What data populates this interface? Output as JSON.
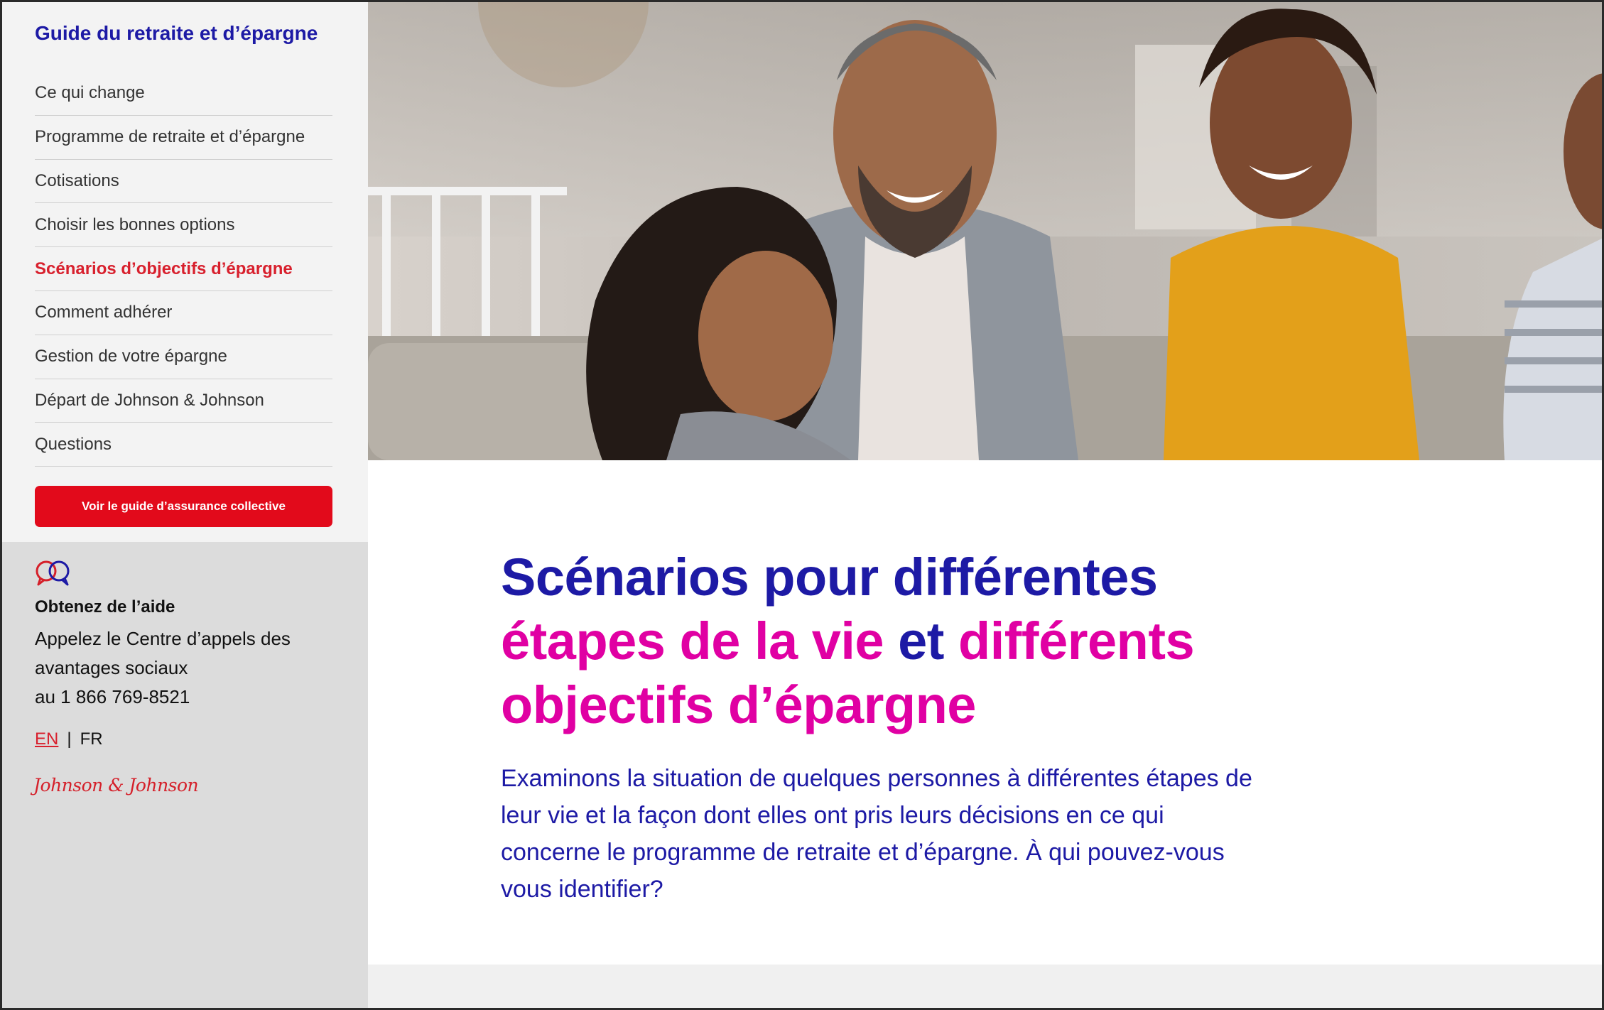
{
  "sidebar": {
    "guide_title": "Guide du retraite et d’épargne",
    "nav": [
      {
        "label": "Ce qui change"
      },
      {
        "label": "Programme de retraite et d’épargne"
      },
      {
        "label": "Cotisations"
      },
      {
        "label": "Choisir les bonnes options"
      },
      {
        "label": "Scénarios d’objectifs d’épargne",
        "active": true
      },
      {
        "label": "Comment adhérer"
      },
      {
        "label": "Gestion de votre épargne"
      },
      {
        "label": "Départ de Johnson & Johnson"
      },
      {
        "label": "Questions"
      }
    ],
    "cta_label": "Voir le guide d’assurance collective",
    "help": {
      "icon": "speech-bubbles-icon",
      "title": "Obtenez de l’aide",
      "line1": "Appelez le Centre d’appels des",
      "line2": "avantages sociaux",
      "line3": "au 1 866 769-8521"
    },
    "lang": {
      "en": "EN",
      "separator": "|",
      "fr": "FR"
    },
    "brand": "Johnson & Johnson"
  },
  "main": {
    "headline": {
      "part1": "Scénarios pour différentes",
      "part2": "étapes de la vie",
      "part3": "et",
      "part4": "différents objectifs d’épargne"
    },
    "intro": "Examinons la situation de quelques personnes à différentes étapes de leur vie et la façon dont elles ont pris leurs décisions en ce qui concerne le programme de retraite et d’épargne. À qui pouvez-vous vous identifier?"
  },
  "colors": {
    "brand_blue": "#1d1aa5",
    "brand_pink": "#e000a3",
    "brand_red": "#e20a1b",
    "active_nav": "#d8202d"
  }
}
